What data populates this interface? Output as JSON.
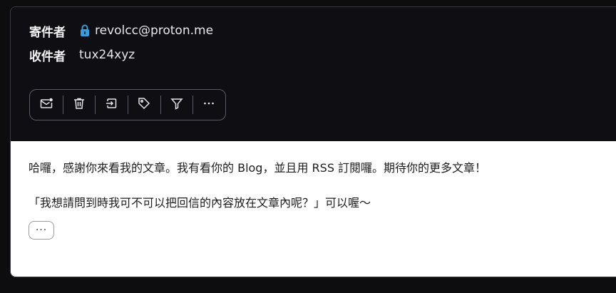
{
  "header": {
    "sender_label": "寄件者",
    "sender_address": "revolcc@proton.me",
    "recipient_label": "收件者",
    "recipient_address": "tux24xyz",
    "lock_color": "#3b9bd8"
  },
  "toolbar": {
    "buttons": [
      {
        "icon": "mark-unread-icon"
      },
      {
        "icon": "trash-icon"
      },
      {
        "icon": "move-to-folder-icon"
      },
      {
        "icon": "label-tag-icon"
      },
      {
        "icon": "filter-icon"
      },
      {
        "icon": "more-options-icon"
      }
    ]
  },
  "message": {
    "line1": "哈囉，感謝你來看我的文章。我有看你的 Blog，並且用 RSS 訂閱囉。期待你的更多文章！",
    "line2": "「我想請問到時我可不可以把回信的內容放在文章內呢？」可以喔〜",
    "expand_label": "···"
  }
}
